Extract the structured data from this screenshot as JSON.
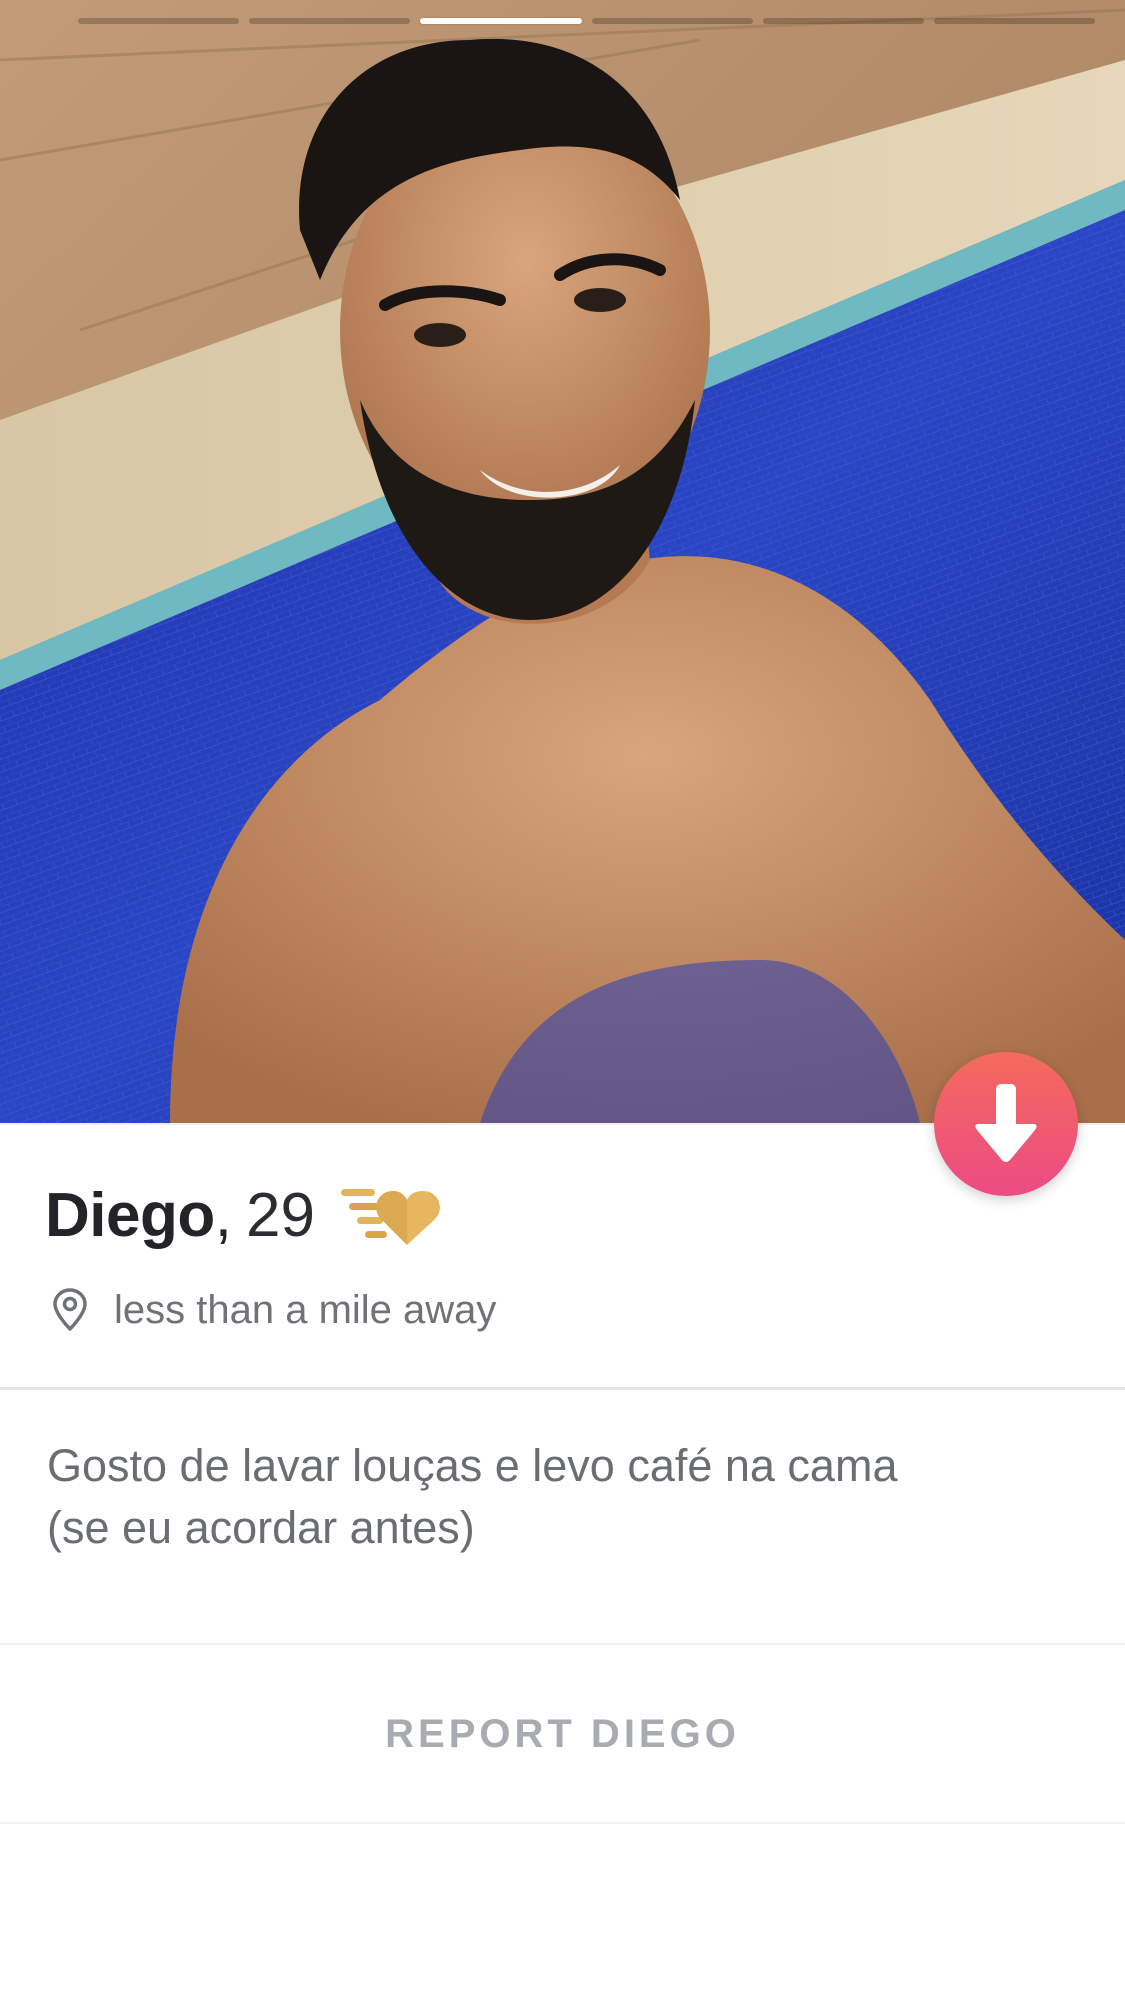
{
  "photo": {
    "indicator_count": 6,
    "active_index": 2
  },
  "profile": {
    "name": "Diego",
    "comma": ",",
    "age": "29",
    "distance": "less than a mile away",
    "bio_line1": "Gosto de lavar louças e levo café na cama",
    "bio_line2": "(se eu acordar antes)",
    "report_label": "REPORT DIEGO"
  },
  "colors": {
    "accent_gradient_top": "#f46b5c",
    "accent_gradient_bottom": "#ec4b84",
    "superlike_gold": "#e2b35c",
    "name_text": "#222427",
    "secondary_text": "#6f7378",
    "report_text": "#a8abb1"
  },
  "icons": {
    "collapse": "arrow-down-icon",
    "superlike": "super-like-heart-icon",
    "location": "location-pin-icon"
  }
}
